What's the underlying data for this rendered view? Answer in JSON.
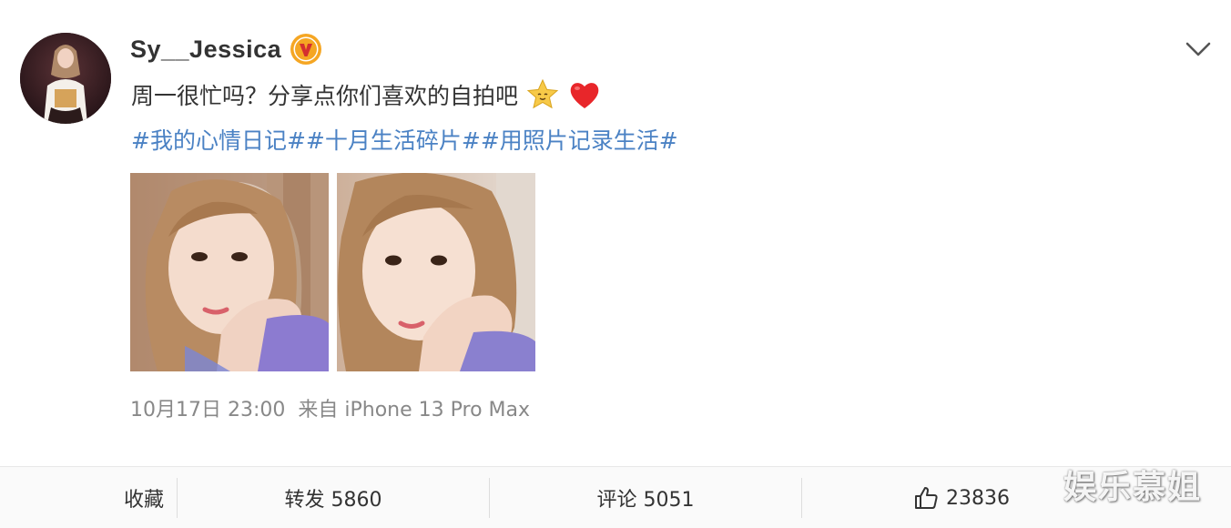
{
  "post": {
    "username": "Sy__Jessica",
    "text": "周一很忙吗？分享点你们喜欢的自拍吧",
    "emojis": [
      "star-face-icon",
      "red-heart-icon"
    ],
    "hashtags": [
      "#我的心情日记#",
      "#十月生活碎片#",
      "#用照片记录生活#"
    ],
    "timestamp": "10月17日 23:00",
    "source": "来自 iPhone 13 Pro Max"
  },
  "actions": {
    "favorite_label": "收藏",
    "repost_label": "转发 5860",
    "comment_label": "评论 5051",
    "like_count": "23836"
  },
  "watermark": "娱乐慕姐",
  "colors": {
    "hashtag": "#4b82c4",
    "text": "#333333",
    "meta": "#888888",
    "verified": "#f5a623"
  }
}
